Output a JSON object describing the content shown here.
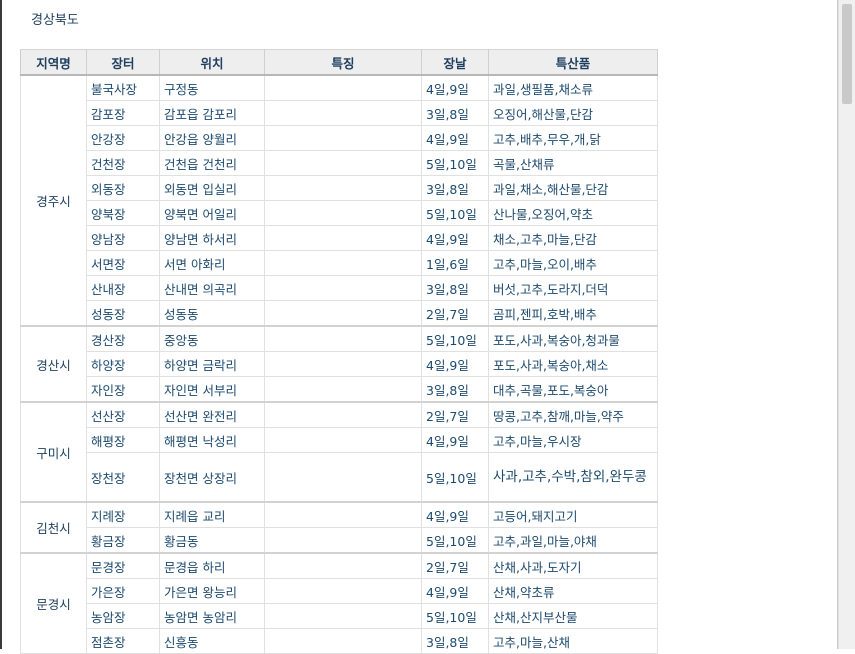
{
  "page": {
    "title": "경상북도"
  },
  "table": {
    "headers": [
      "지역명",
      "장터",
      "위치",
      "특징",
      "장날",
      "특산품"
    ],
    "groups": [
      {
        "region": "경주시",
        "rows": [
          {
            "market": "불국사장",
            "location": "구정동",
            "feature": "",
            "days": "4일,9일",
            "products": "과일,생필품,채소류"
          },
          {
            "market": "감포장",
            "location": "감포읍 감포리",
            "feature": "",
            "days": "3일,8일",
            "products": "오징어,해산물,단감"
          },
          {
            "market": "안강장",
            "location": "안강읍 양월리",
            "feature": "",
            "days": "4일,9일",
            "products": "고추,배추,무우,개,닭"
          },
          {
            "market": "건천장",
            "location": "건천읍 건천리",
            "feature": "",
            "days": "5일,10일",
            "products": "곡물,산채류"
          },
          {
            "market": "외동장",
            "location": "외동면 입실리",
            "feature": "",
            "days": "3일,8일",
            "products": "과일,채소,해산물,단감"
          },
          {
            "market": "양북장",
            "location": "양북면 어일리",
            "feature": "",
            "days": "5일,10일",
            "products": "산나물,오징어,약초"
          },
          {
            "market": "양남장",
            "location": "양남면 하서리",
            "feature": "",
            "days": "4일,9일",
            "products": "채소,고추,마늘,단감"
          },
          {
            "market": "서면장",
            "location": "서면 아화리",
            "feature": "",
            "days": "1일,6일",
            "products": "고추,마늘,오이,배추"
          },
          {
            "market": "산내장",
            "location": "산내면 의곡리",
            "feature": "",
            "days": "3일,8일",
            "products": "버섯,고추,도라지,더덕"
          },
          {
            "market": "성동장",
            "location": "성동동",
            "feature": "",
            "days": "2일,7일",
            "products": "곰피,젠피,호박,배추"
          }
        ]
      },
      {
        "region": "경산시",
        "rows": [
          {
            "market": "경산장",
            "location": "중앙동",
            "feature": "",
            "days": "5일,10일",
            "products": "포도,사과,복숭아,청과물"
          },
          {
            "market": "하양장",
            "location": "하양면 금락리",
            "feature": "",
            "days": "4일,9일",
            "products": "포도,사과,복숭아,채소"
          },
          {
            "market": "자인장",
            "location": "자인면 서부리",
            "feature": "",
            "days": "3일,8일",
            "products": "대추,곡물,포도,복숭아"
          }
        ]
      },
      {
        "region": "구미시",
        "rows": [
          {
            "market": "선산장",
            "location": "선산면 완전리",
            "feature": "",
            "days": "2일,7일",
            "products": "땅콩,고추,참깨,마늘,약주"
          },
          {
            "market": "해평장",
            "location": "해평면 낙성리",
            "feature": "",
            "days": "4일,9일",
            "products": "고추,마늘,우시장"
          },
          {
            "market": "장천장",
            "location": "장천면 상장리",
            "feature": "",
            "days": "5일,10일",
            "products": "사과,고추,수박,참외,완두콩",
            "tall": true
          }
        ]
      },
      {
        "region": "김천시",
        "rows": [
          {
            "market": "지례장",
            "location": "지례읍 교리",
            "feature": "",
            "days": "4일,9일",
            "products": "고등어,돼지고기"
          },
          {
            "market": "황금장",
            "location": "황금동",
            "feature": "",
            "days": "5일,10일",
            "products": "고추,과일,마늘,야채"
          }
        ]
      },
      {
        "region": "문경시",
        "rows": [
          {
            "market": "문경장",
            "location": "문경읍 하리",
            "feature": "",
            "days": "2일,7일",
            "products": "산채,사과,도자기"
          },
          {
            "market": "가은장",
            "location": "가은면 왕능리",
            "feature": "",
            "days": "4일,9일",
            "products": "산채,약초류"
          },
          {
            "market": "농암장",
            "location": "농암면 농암리",
            "feature": "",
            "days": "5일,10일",
            "products": "산채,산지부산물"
          },
          {
            "market": "점촌장",
            "location": "신흥동",
            "feature": "",
            "days": "3일,8일",
            "products": "고추,마늘,산채"
          }
        ]
      }
    ]
  }
}
